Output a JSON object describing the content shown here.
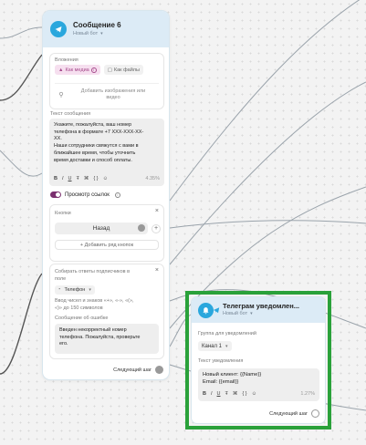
{
  "message_card": {
    "title": "Сообщение 6",
    "bot_name": "Новый бот",
    "attachments": {
      "label": "Вложения",
      "as_media": "Как медиа",
      "as_files": "Как файлы",
      "add_media_label": "Добавить изображения или видео"
    },
    "message_text": {
      "label": "Текст сообщения",
      "lines": [
        "Укажите, пожалуйста, ваш номер",
        "телефона в формате +7 XXX-XXX-XX-",
        "XX.",
        "Наши сотрудники свяжутся с вами в",
        "ближайшее время, чтобы уточнить",
        "время доставки и способ оплаты."
      ],
      "percent": "4.35%"
    },
    "preview_links_label": "Просмотр ссылок",
    "buttons": {
      "label": "Кнопки",
      "back_button": "Назад",
      "add_row": "+ Добавить ряд кнопок"
    },
    "collect": {
      "label_lines": [
        "Собирать ответы подписчиков в",
        "поле"
      ],
      "field": "Телефон",
      "hint_lines": [
        "Ввод чисел и знаков «+», «-», «(»,",
        "«)» до 150 символов"
      ],
      "error_label": "Сообщение об ошибке",
      "error_lines": [
        "Введен некорректный номер",
        "телефона. Пожалуйста, проверьте",
        "его."
      ]
    },
    "next_step": "Следующий шаг"
  },
  "notify_card": {
    "title": "Телеграм уведомлен...",
    "bot_name": "Новый бот",
    "group_label": "Группа для уведомлений",
    "group_value": "Канал 1",
    "text_label": "Текст уведомления",
    "text_lines": [
      "Новый клиент: {{Name}}",
      "Email: {{email}}"
    ],
    "percent": "1.27%",
    "next_step": "Следующий шаг"
  },
  "toolbar_glyphs": [
    "B",
    "I",
    "U",
    "Ŧ",
    "⌘",
    "{ }",
    "☺"
  ],
  "colors": {
    "telegram_blue": "#2aa7dd",
    "header_bg": "#dcebf6",
    "accent_purple": "#7a2f6e",
    "highlight_green": "#2aa13a"
  }
}
